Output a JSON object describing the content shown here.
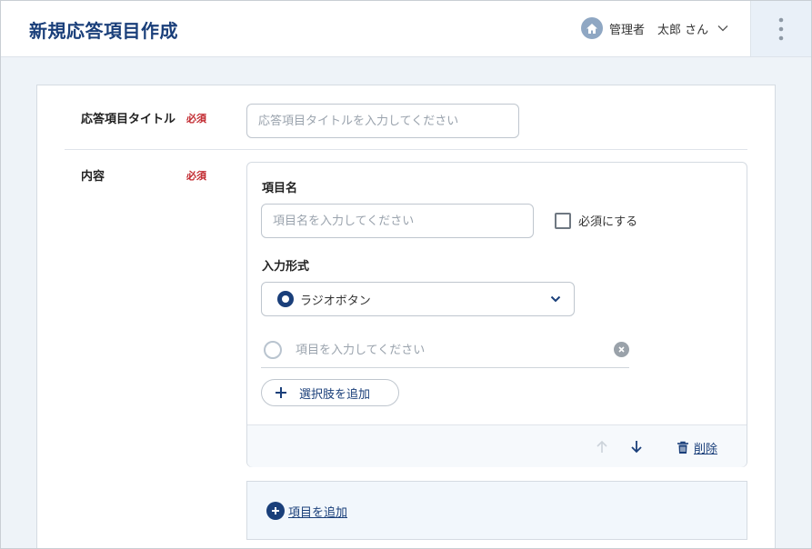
{
  "header": {
    "title": "新規応答項目作成",
    "role": "管理者",
    "user_name": "太郎 さん",
    "icons": {
      "home": "home-icon",
      "menu": "kebab-menu-icon",
      "chevron": "chevron-down-icon"
    }
  },
  "form": {
    "title_field": {
      "label": "応答項目タイトル",
      "required": "必須",
      "placeholder": "応答項目タイトルを入力してください",
      "value": ""
    },
    "content_field": {
      "label": "内容",
      "required": "必須"
    },
    "item": {
      "name_label": "項目名",
      "name_placeholder": "項目名を入力してください",
      "name_value": "",
      "required_checkbox_label": "必須にする",
      "required_checked": false,
      "input_type_label": "入力形式",
      "input_type_value": "ラジオボタン",
      "option_placeholder": "項目を入力してください",
      "option_value": "",
      "add_option_label": "選択肢を追加",
      "delete_label": "削除"
    },
    "add_item_label": "項目を追加"
  },
  "colors": {
    "primary": "#1a3f7a",
    "required": "#c1272d",
    "background": "#eef3f8"
  }
}
